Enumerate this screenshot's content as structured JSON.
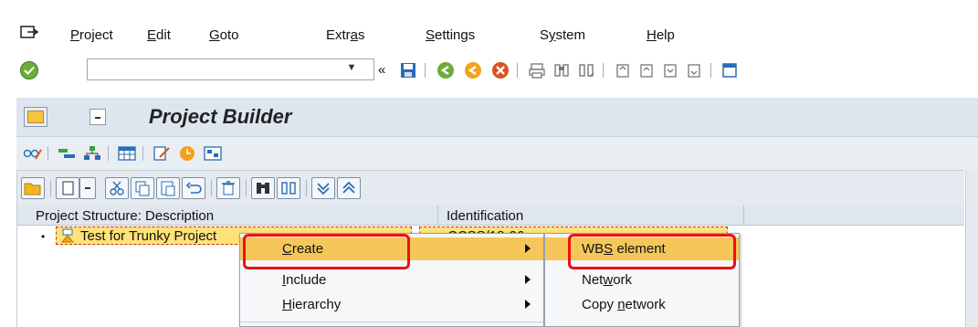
{
  "menubar": {
    "items": [
      {
        "label": "Project",
        "underline": "P",
        "rest": "roject"
      },
      {
        "label": "Edit",
        "underline": "E",
        "rest": "dit"
      },
      {
        "label": "Goto",
        "underline": "G",
        "rest": "oto"
      },
      {
        "label": "Extras",
        "pre": "Extr",
        "underline": "a",
        "rest": "s"
      },
      {
        "label": "Settings",
        "underline": "S",
        "rest": "ettings"
      },
      {
        "label": "System",
        "pre": "S",
        "underline": "y",
        "rest": "stem"
      },
      {
        "label": "Help",
        "underline": "H",
        "rest": "elp"
      }
    ]
  },
  "toolbar": {
    "command_value": "",
    "history_label": "«"
  },
  "title": {
    "text": "Project Builder"
  },
  "table": {
    "columns": [
      "Project Structure: Description",
      "Identification"
    ],
    "rows": [
      {
        "description": "Test for Trunky Project",
        "identification": "CCSS/18-26"
      }
    ]
  },
  "context_menu": {
    "items": [
      {
        "pre": "",
        "underline": "C",
        "rest": "reate",
        "has_submenu": true,
        "highlighted": true
      },
      {
        "pre": "",
        "underline": "I",
        "rest": "nclude",
        "has_submenu": true,
        "highlighted": false
      },
      {
        "pre": "",
        "underline": "H",
        "rest": "ierarchy",
        "has_submenu": true,
        "highlighted": false
      }
    ]
  },
  "submenu": {
    "items": [
      {
        "pre": "WB",
        "underline": "S",
        "rest": " element",
        "highlighted": true,
        "dim": false
      },
      {
        "pre": "Net",
        "underline": "w",
        "rest": "ork",
        "highlighted": false,
        "dim": false
      },
      {
        "pre": "Copy ",
        "underline": "n",
        "rest": "etwork",
        "highlighted": false,
        "dim": false
      }
    ]
  },
  "colors": {
    "highlight": "#f5c75a",
    "callout": "#ee1111",
    "title_bg": "#dde6ef",
    "node_bg": "#ffe27a"
  }
}
